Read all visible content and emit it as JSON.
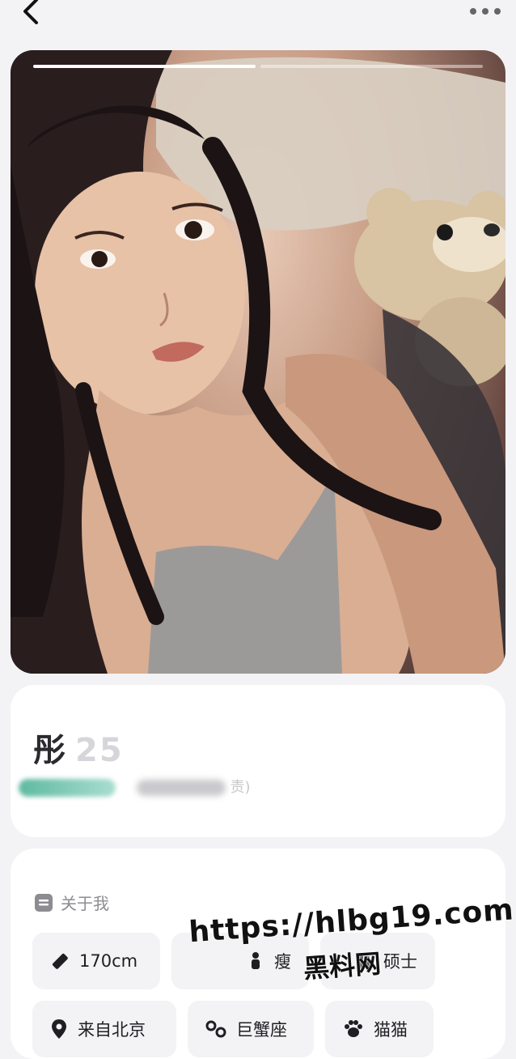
{
  "profile": {
    "name": "彤",
    "age": "25",
    "subtitle_tail": "责)"
  },
  "about": {
    "title": "关于我",
    "tags_row1": [
      {
        "label": "170cm",
        "icon": "ruler-icon"
      },
      {
        "label": "瘦",
        "icon": "body-icon"
      },
      {
        "label": "硕士",
        "icon": "education-icon"
      }
    ],
    "tags_row2": [
      {
        "label": "来自北京",
        "icon": "location-icon"
      },
      {
        "label": "巨蟹座",
        "icon": "cancer-zodiac-icon"
      },
      {
        "label": "猫猫",
        "icon": "paw-icon"
      }
    ]
  },
  "photo": {
    "count": 2,
    "active_index": 0
  },
  "watermark": {
    "url": "https://hlbg19.com",
    "cn": "黑料网"
  }
}
